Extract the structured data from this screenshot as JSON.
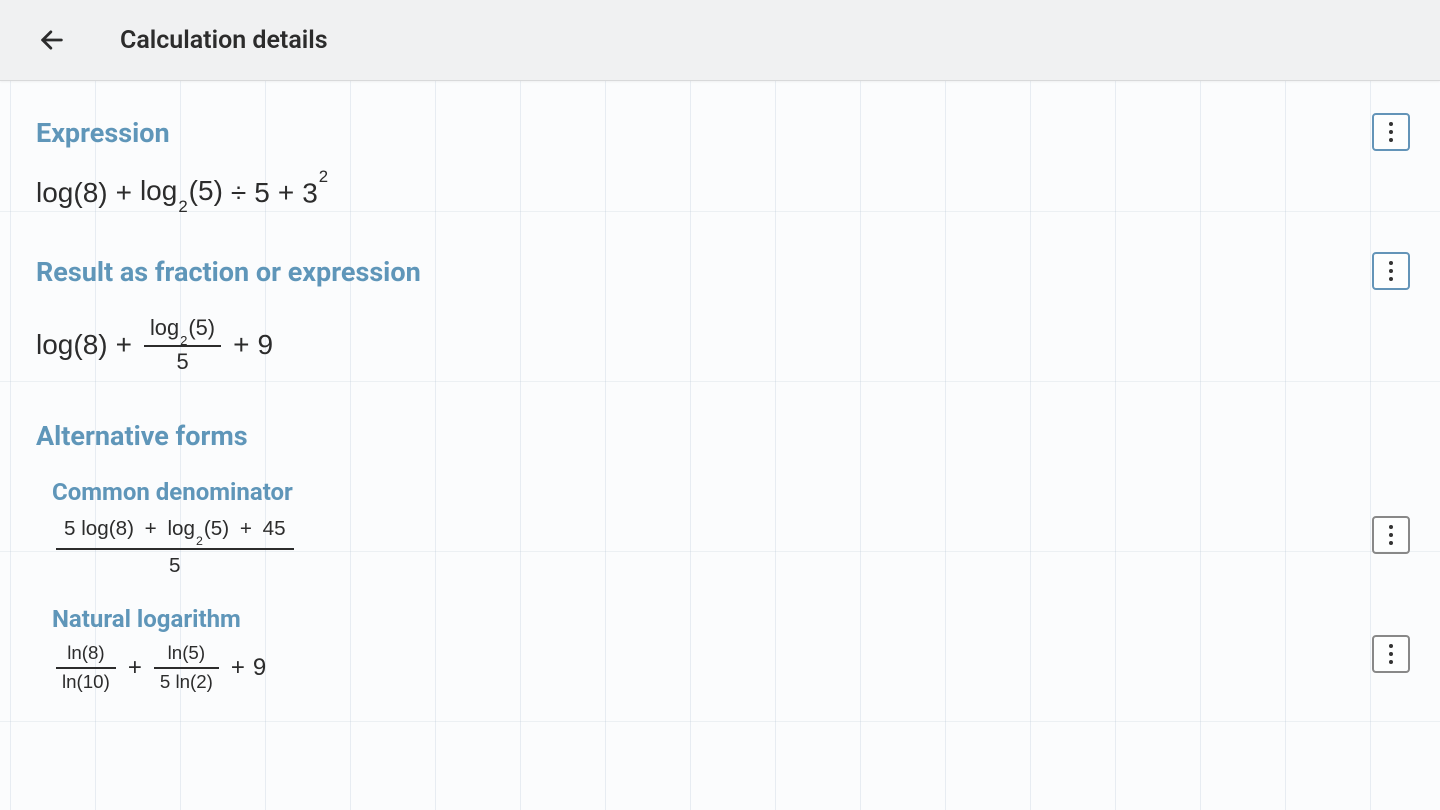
{
  "header": {
    "title": "Calculation details"
  },
  "sections": {
    "expression": {
      "title": "Expression",
      "parts": {
        "p1": "log(8)",
        "op1": "+",
        "p2a": "log",
        "p2sub": "2",
        "p2b": "(5)",
        "op2": "÷",
        "p3": "5",
        "op3": "+",
        "p4": "3",
        "p4sup": "2"
      }
    },
    "result": {
      "title": "Result as fraction or expression",
      "parts": {
        "p1": "log(8)",
        "op1": "+",
        "frac_num_a": "log",
        "frac_num_sub": "2",
        "frac_num_b": "(5)",
        "frac_den": "5",
        "op2": "+",
        "p3": "9"
      }
    },
    "alternative": {
      "title": "Alternative forms",
      "common_denominator": {
        "title": "Common denominator",
        "num_a": "5 log(8)",
        "num_op1": "+",
        "num_b1": "log",
        "num_b_sub": "2",
        "num_b2": "(5)",
        "num_op2": "+",
        "num_c": "45",
        "den": "5"
      },
      "natural_logarithm": {
        "title": "Natural logarithm",
        "f1_num": "ln(8)",
        "f1_den": "ln(10)",
        "op1": "+",
        "f2_num": "ln(5)",
        "f2_den": "5 ln(2)",
        "op2": "+",
        "p3": "9"
      }
    }
  }
}
